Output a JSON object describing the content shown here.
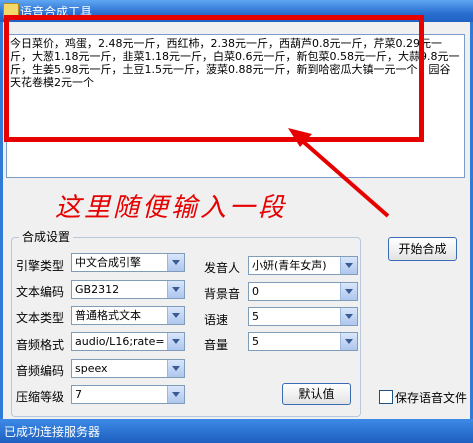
{
  "window": {
    "title": "语音合成工具"
  },
  "editor": {
    "text": "今日菜价，鸡蛋，2.48元一斤，西红柿，2.38元一斤，西葫芦0.8元一斤，芹菜0.29元一斤，大葱1.18元一斤，韭菜1.18元一斤，白菜0.6元一斤，新包菜0.58元一斤，大蒜9.8元一斤，生姜5.98元一斤，土豆1.5元一斤，菠菜0.88元一斤，新到哈密瓜大镇一元一个，园谷天花卷模2元一个"
  },
  "annotation": {
    "text": "这里随便输入一段"
  },
  "settings": {
    "group_title": "合成设置",
    "engine_type": {
      "label": "引擎类型",
      "value": "中文合成引擎"
    },
    "text_encoding": {
      "label": "文本编码",
      "value": "GB2312"
    },
    "text_type": {
      "label": "文本类型",
      "value": "普通格式文本"
    },
    "audio_format": {
      "label": "音频格式",
      "value": "audio/L16;rate="
    },
    "audio_encoding": {
      "label": "音频编码",
      "value": "speex"
    },
    "compression": {
      "label": "压缩等级",
      "value": "7"
    },
    "speaker": {
      "label": "发音人",
      "value": "小妍(青年女声)"
    },
    "background": {
      "label": "背景音",
      "value": "0"
    },
    "speed": {
      "label": "语速",
      "value": "5"
    },
    "volume": {
      "label": "音量",
      "value": "5"
    },
    "default_button": "默认值"
  },
  "actions": {
    "start_button": "开始合成",
    "save_label": "保存语音文件"
  },
  "status": {
    "text": "已成功连接服务器"
  },
  "colors": {
    "annotation": "#e60000",
    "titlebar": "#2a6fd0",
    "statusbar": "#1d5fc0"
  }
}
